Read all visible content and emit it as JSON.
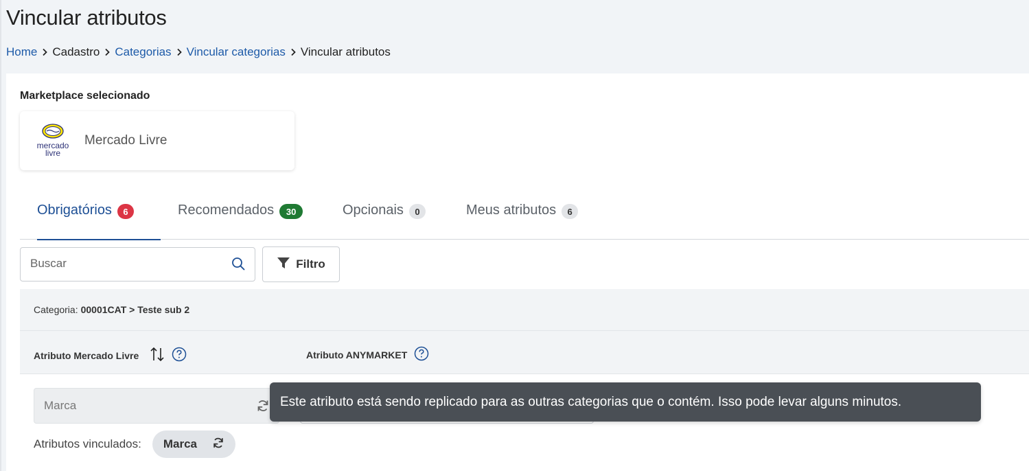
{
  "page": {
    "title": "Vincular atributos"
  },
  "breadcrumb": {
    "items": [
      {
        "label": "Home",
        "link": true
      },
      {
        "label": "Cadastro",
        "link": false
      },
      {
        "label": "Categorias",
        "link": true
      },
      {
        "label": "Vincular categorias",
        "link": true
      },
      {
        "label": "Vincular atributos",
        "link": false
      }
    ]
  },
  "marketplace": {
    "section_label": "Marketplace selecionado",
    "name": "Mercado Livre",
    "logo_text_line1": "mercado",
    "logo_text_line2": "livre",
    "logo_color": "#ffe600"
  },
  "tabs": [
    {
      "label": "Obrigatórios",
      "count": "6",
      "active": true
    },
    {
      "label": "Recomendados",
      "count": "30",
      "active": false
    },
    {
      "label": "Opcionais",
      "count": "0",
      "active": false
    },
    {
      "label": "Meus atributos",
      "count": "6",
      "active": false
    }
  ],
  "search": {
    "placeholder": "Buscar",
    "icon": "search-icon"
  },
  "filter": {
    "label": "Filtro",
    "icon": "funnel-icon"
  },
  "category": {
    "label": "Categoria:",
    "value": "00001CAT > Teste sub 2"
  },
  "table_header": {
    "col1": "Atributo Mercado Livre",
    "col2": "Atributo ANYMARKET"
  },
  "row": {
    "marketplace_attribute": "Marca",
    "anymarket_attribute": "",
    "linked_label": "Atributos vinculados:",
    "linked_chip": "Marca"
  },
  "tooltip": {
    "text": "Este atributo está sendo replicado para as outras categorias que o contém. Isso pode levar alguns minutos."
  },
  "colors": {
    "accent": "#1d4f95",
    "link": "#1d5aa8",
    "badge_red": "#dc3545",
    "badge_green": "#1f7a33",
    "tooltip_bg": "#4a4f55"
  }
}
